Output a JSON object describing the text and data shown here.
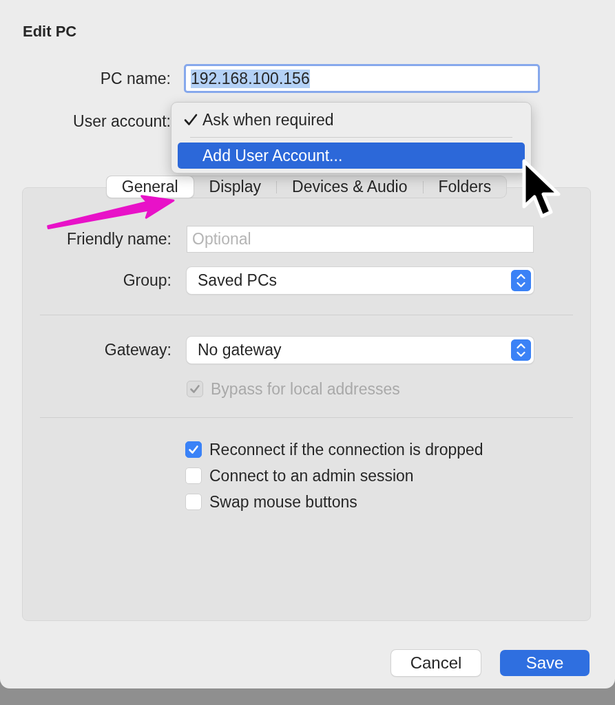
{
  "dialog": {
    "title": "Edit PC"
  },
  "pc_name": {
    "label": "PC name:",
    "value": "192.168.100.156",
    "text_selected": true
  },
  "user_account": {
    "label": "User account:",
    "menu": [
      {
        "kind": "item",
        "label": "Ask when required",
        "checked": true,
        "selected": false
      },
      {
        "kind": "separator"
      },
      {
        "kind": "item",
        "label": "Add User Account...",
        "checked": false,
        "selected": true
      }
    ]
  },
  "tabs": [
    {
      "label": "General",
      "selected": true
    },
    {
      "label": "Display",
      "selected": false
    },
    {
      "label": "Devices & Audio",
      "selected": false
    },
    {
      "label": "Folders",
      "selected": false
    }
  ],
  "friendly_name": {
    "label": "Friendly name:",
    "placeholder": "Optional"
  },
  "group": {
    "label": "Group:",
    "value": "Saved PCs"
  },
  "gateway": {
    "label": "Gateway:",
    "value": "No gateway",
    "bypass": {
      "label": "Bypass for local addresses",
      "checked": true,
      "disabled": true
    }
  },
  "options": [
    {
      "label": "Reconnect if the connection is dropped",
      "checked": true
    },
    {
      "label": "Connect to an admin session",
      "checked": false
    },
    {
      "label": "Swap mouse buttons",
      "checked": false
    }
  ],
  "buttons": [
    {
      "label": "Cancel",
      "kind": "secondary"
    },
    {
      "label": "Save",
      "kind": "primary"
    }
  ]
}
